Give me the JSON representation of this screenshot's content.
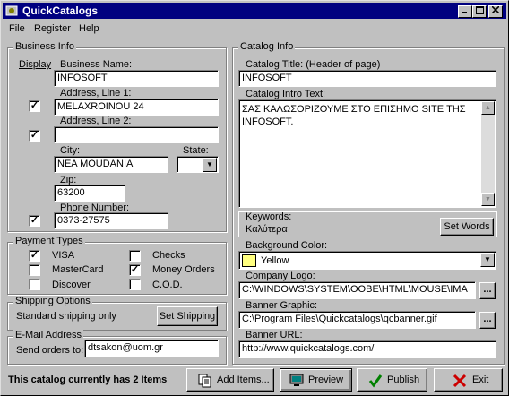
{
  "window": {
    "title": "QuickCatalogs"
  },
  "menu": {
    "file": "File",
    "register": "Register",
    "help": "Help"
  },
  "business": {
    "group_label": "Business Info",
    "display_label": "Display",
    "name_label": "Business Name:",
    "name_value": "INFOSOFT",
    "address1_label": "Address, Line 1:",
    "address1_value": "MELAXROINOU 24",
    "address1_display": true,
    "address2_label": "Address, Line 2:",
    "address2_value": "",
    "address2_display": true,
    "city_label": "City:",
    "city_value": "NEA MOUDANIA",
    "state_label": "State:",
    "state_value": "",
    "zip_label": "Zip:",
    "zip_value": "63200",
    "phone_label": "Phone Number:",
    "phone_value": "0373-27575",
    "phone_display": true
  },
  "payment": {
    "group_label": "Payment Types",
    "items": [
      {
        "label": "VISA",
        "checked": true
      },
      {
        "label": "MasterCard",
        "checked": false
      },
      {
        "label": "Discover",
        "checked": false
      },
      {
        "label": "Checks",
        "checked": false
      },
      {
        "label": "Money Orders",
        "checked": true
      },
      {
        "label": "C.O.D.",
        "checked": false
      }
    ]
  },
  "shipping": {
    "group_label": "Shipping Options",
    "current": "Standard shipping only",
    "button": "Set Shipping"
  },
  "email": {
    "group_label": "E-Mail Address",
    "send_label": "Send orders to:",
    "value": "dtsakon@uom.gr"
  },
  "catalog": {
    "group_label": "Catalog Info",
    "title_label": "Catalog Title: (Header of page)",
    "title_value": "INFOSOFT",
    "intro_label": "Catalog Intro Text:",
    "intro_value": "ΣΑΣ ΚΑΛΩΣΟΡΙΖΟΥΜΕ ΣΤΟ ΕΠΙΣΗΜΟ SITE ΤΗΣ INFOSOFT.",
    "keywords_label": "Keywords:",
    "keywords_value": "Καλύτερα",
    "set_words_button": "Set Words",
    "bg_label": "Background Color:",
    "bg_value": "Yellow",
    "bg_swatch": "#ffff80",
    "logo_label": "Company Logo:",
    "logo_value": "C:\\WINDOWS\\SYSTEM\\OOBE\\HTML\\MOUSE\\IMA",
    "banner_label": "Banner Graphic:",
    "banner_value": "C:\\Program Files\\Quickcatalogs\\qcbanner.gif",
    "url_label": "Banner URL:",
    "url_value": "http://www.quickcatalogs.com/",
    "browse_button": "..."
  },
  "footer": {
    "status": "This catalog currently has 2 Items",
    "add_items": "Add Items...",
    "preview": "Preview",
    "publish": "Publish",
    "exit": "Exit"
  },
  "colors": {
    "titlebar": "#000080",
    "face": "#c0c0c0",
    "exit_x": "#cc0000",
    "publish_check": "#008000"
  }
}
